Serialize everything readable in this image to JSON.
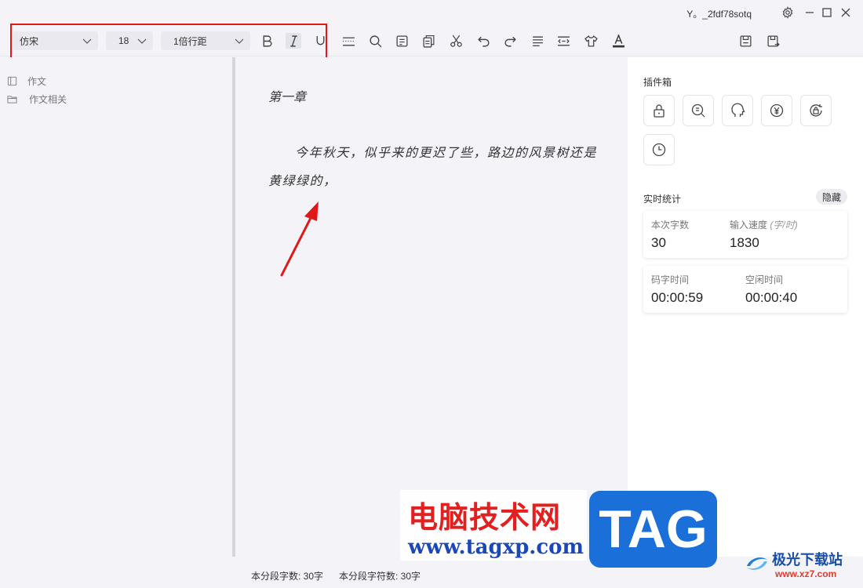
{
  "titlebar": {
    "username": "Y。_2fdf78sotq"
  },
  "toolbar": {
    "font_family": "仿宋",
    "font_size": "18",
    "line_spacing": "1倍行距",
    "icons": [
      "bold-icon",
      "italic-icon",
      "underline-icon",
      "divider-icon",
      "search-icon",
      "note-icon",
      "copy-icon",
      "cut-icon",
      "undo-icon",
      "redo-icon",
      "align-icon",
      "indent-icon",
      "theme-shirt-icon",
      "font-color-icon",
      "save-icon",
      "save-as-icon"
    ],
    "accent_color": "#e01818"
  },
  "sidebar": {
    "items": [
      {
        "label": "作文",
        "icon": "book-icon"
      },
      {
        "label": "作文相关",
        "icon": "folder-icon"
      }
    ]
  },
  "editor": {
    "chapter_title": "第一章",
    "content": "今年秋天，似乎来的更迟了些，路边的风景树还是黄绿绿的，"
  },
  "statusbar": {
    "paragraph_chars": "本分段字数: 30字",
    "paragraph_symbols": "本分段字符数: 30字"
  },
  "rightpanel": {
    "plugin_title": "插件箱",
    "plugins": [
      "lock-icon",
      "dictionary-search-icon",
      "head-icon",
      "yuan-icon",
      "lock-refresh-icon",
      "clock-icon"
    ],
    "stats_title": "实时统计",
    "hide_label": "隐藏",
    "stats": {
      "session_chars_label": "本次字数",
      "session_chars_value": "30",
      "speed_label": "输入速度",
      "speed_unit": "(字/时)",
      "speed_value": "1830",
      "typing_time_label": "码字时间",
      "typing_time_value": "00:00:59",
      "idle_time_label": "空闲时间",
      "idle_time_value": "00:00:40"
    }
  },
  "watermark": {
    "site_cn": "电脑技术网",
    "site_url": "www.tagxp.com",
    "tag": "TAG",
    "logo_name": "极光下载站",
    "logo_url": "www.xz7.com"
  }
}
